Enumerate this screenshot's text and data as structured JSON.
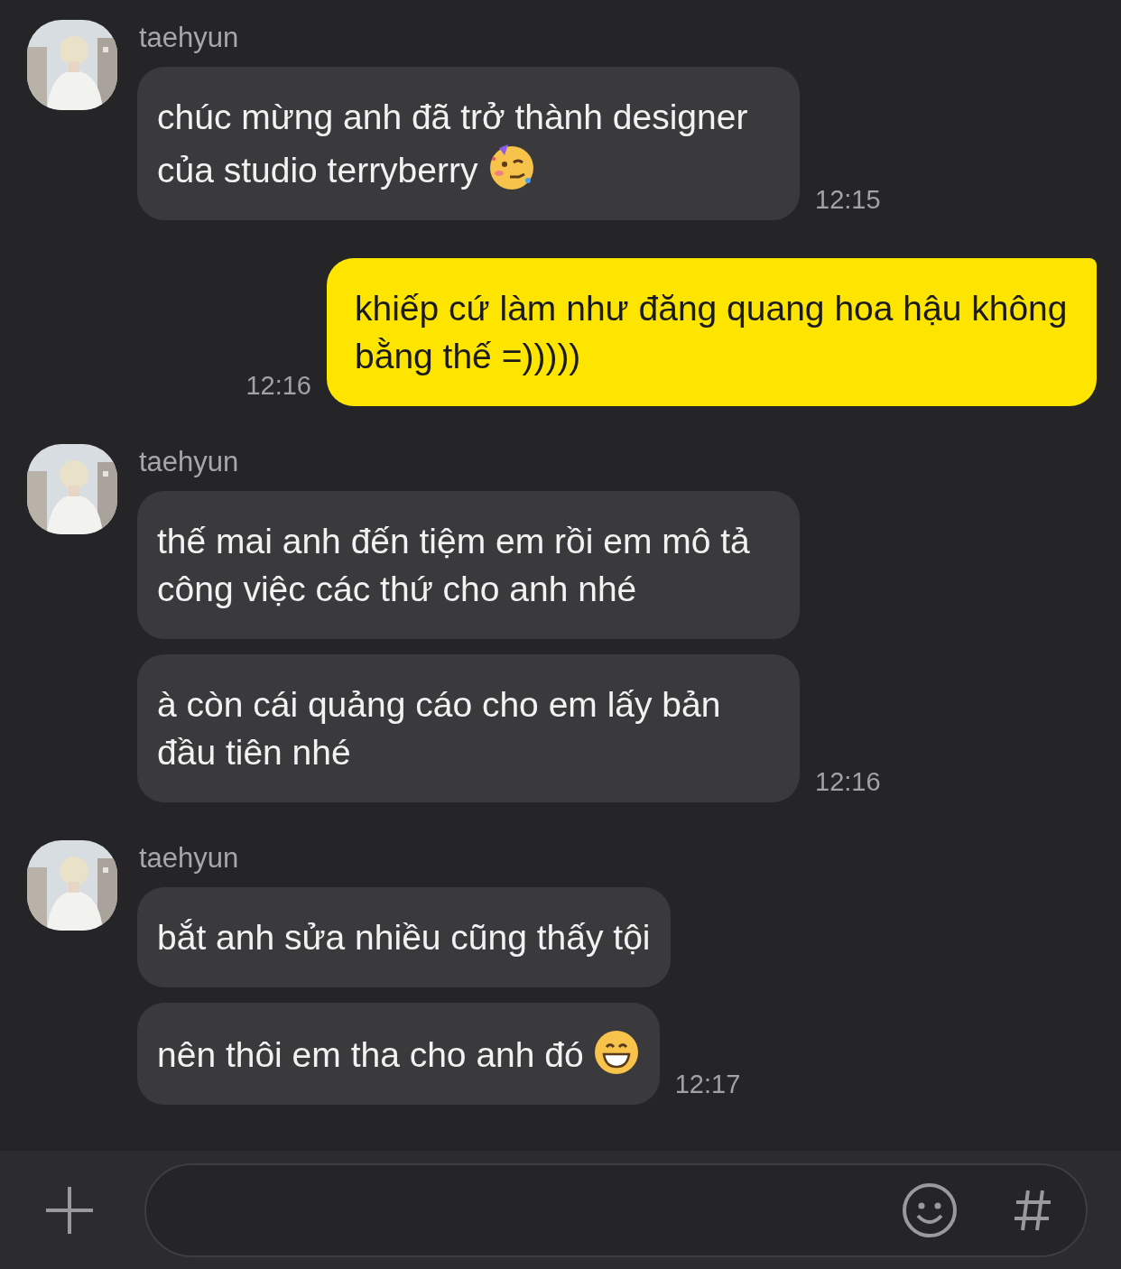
{
  "messages": [
    {
      "kind": "received",
      "sender": "taehyun",
      "avatar": {
        "kind": "picture"
      },
      "bubbles": [
        {
          "text": "chúc mừng anh đã trở thành designer của studio terryberry",
          "kind": "party"
        }
      ],
      "time": "12:15"
    },
    {
      "kind": "sent",
      "bubbles": [
        {
          "text": "khiếp cứ làm như đăng quang hoa hậu không bằng thế =)))))"
        }
      ],
      "time": "12:16"
    },
    {
      "kind": "received",
      "sender": "taehyun",
      "avatar": {
        "kind": "picture"
      },
      "bubbles": [
        {
          "text": "thế mai anh đến tiệm em rồi em mô tả công việc các thứ cho anh nhé"
        },
        {
          "text": "à còn cái quảng cáo cho em lấy bản đầu tiên nhé"
        }
      ],
      "time": "12:16"
    },
    {
      "kind": "received",
      "sender": "taehyun",
      "avatar": {
        "kind": "picture"
      },
      "bubbles": [
        {
          "text": "bắt anh sửa nhiều cũng thấy tội"
        },
        {
          "text": "nên thôi em tha cho anh đó",
          "kind": "grin"
        }
      ],
      "time": "12:17"
    }
  ],
  "composer": {
    "buttons": [
      {
        "kind": "plus"
      },
      {
        "kind": "emoji"
      },
      {
        "kind": "hashtag"
      }
    ]
  }
}
